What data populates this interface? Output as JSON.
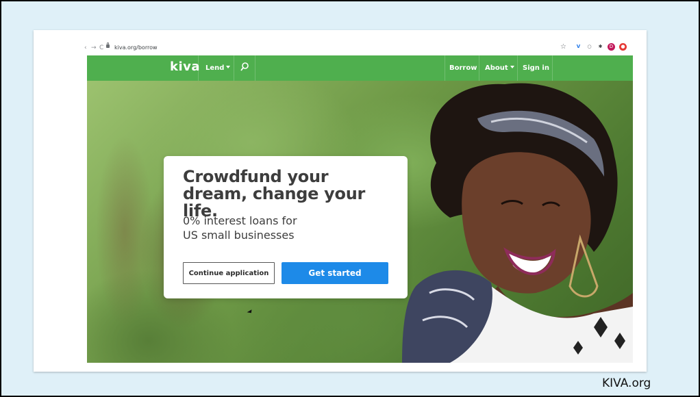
{
  "browser": {
    "url": "kiva.org/borrow",
    "back_icon": "arrow-left-icon",
    "forward_icon": "arrow-right-icon",
    "reload_icon": "reload-icon",
    "extensions": [
      {
        "name": "star-icon",
        "glyph": "☆",
        "color": "#5f6368"
      },
      {
        "name": "vee-extension-icon",
        "glyph": "V",
        "color": "#1a73e8"
      },
      {
        "name": "circle-extension-icon",
        "glyph": "◯",
        "color": "#5f6368"
      },
      {
        "name": "puzzle-extension-icon",
        "glyph": "✱",
        "color": "#3c4043"
      },
      {
        "name": "profile-avatar-icon",
        "glyph": "D",
        "color": "#c2185b"
      },
      {
        "name": "red-extension-icon",
        "glyph": "●",
        "color": "#e53935"
      }
    ]
  },
  "nav": {
    "logo": "kiva",
    "lend": "Lend",
    "borrow": "Borrow",
    "about": "About",
    "sign_in": "Sign in",
    "bg_color": "#4faf4e"
  },
  "hero": {
    "headline": "Crowdfund your dream, change your life.",
    "subline_1": "0% interest loans for",
    "subline_2": "US small businesses",
    "continue_label": "Continue application",
    "get_started_label": "Get started",
    "primary_color": "#1d8ae8"
  },
  "caption": "KIVA.org"
}
